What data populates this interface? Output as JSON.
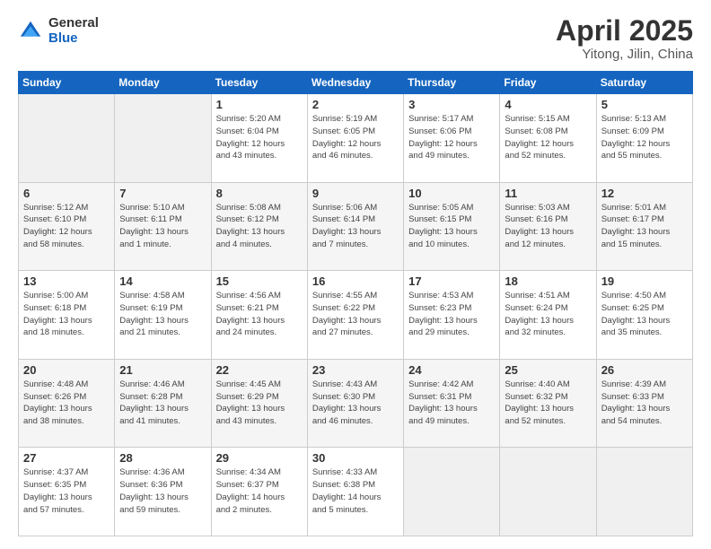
{
  "logo": {
    "general": "General",
    "blue": "Blue"
  },
  "title": {
    "month": "April 2025",
    "location": "Yitong, Jilin, China"
  },
  "days_of_week": [
    "Sunday",
    "Monday",
    "Tuesday",
    "Wednesday",
    "Thursday",
    "Friday",
    "Saturday"
  ],
  "weeks": [
    [
      {
        "day": "",
        "info": ""
      },
      {
        "day": "",
        "info": ""
      },
      {
        "day": "1",
        "info": "Sunrise: 5:20 AM\nSunset: 6:04 PM\nDaylight: 12 hours\nand 43 minutes."
      },
      {
        "day": "2",
        "info": "Sunrise: 5:19 AM\nSunset: 6:05 PM\nDaylight: 12 hours\nand 46 minutes."
      },
      {
        "day": "3",
        "info": "Sunrise: 5:17 AM\nSunset: 6:06 PM\nDaylight: 12 hours\nand 49 minutes."
      },
      {
        "day": "4",
        "info": "Sunrise: 5:15 AM\nSunset: 6:08 PM\nDaylight: 12 hours\nand 52 minutes."
      },
      {
        "day": "5",
        "info": "Sunrise: 5:13 AM\nSunset: 6:09 PM\nDaylight: 12 hours\nand 55 minutes."
      }
    ],
    [
      {
        "day": "6",
        "info": "Sunrise: 5:12 AM\nSunset: 6:10 PM\nDaylight: 12 hours\nand 58 minutes."
      },
      {
        "day": "7",
        "info": "Sunrise: 5:10 AM\nSunset: 6:11 PM\nDaylight: 13 hours\nand 1 minute."
      },
      {
        "day": "8",
        "info": "Sunrise: 5:08 AM\nSunset: 6:12 PM\nDaylight: 13 hours\nand 4 minutes."
      },
      {
        "day": "9",
        "info": "Sunrise: 5:06 AM\nSunset: 6:14 PM\nDaylight: 13 hours\nand 7 minutes."
      },
      {
        "day": "10",
        "info": "Sunrise: 5:05 AM\nSunset: 6:15 PM\nDaylight: 13 hours\nand 10 minutes."
      },
      {
        "day": "11",
        "info": "Sunrise: 5:03 AM\nSunset: 6:16 PM\nDaylight: 13 hours\nand 12 minutes."
      },
      {
        "day": "12",
        "info": "Sunrise: 5:01 AM\nSunset: 6:17 PM\nDaylight: 13 hours\nand 15 minutes."
      }
    ],
    [
      {
        "day": "13",
        "info": "Sunrise: 5:00 AM\nSunset: 6:18 PM\nDaylight: 13 hours\nand 18 minutes."
      },
      {
        "day": "14",
        "info": "Sunrise: 4:58 AM\nSunset: 6:19 PM\nDaylight: 13 hours\nand 21 minutes."
      },
      {
        "day": "15",
        "info": "Sunrise: 4:56 AM\nSunset: 6:21 PM\nDaylight: 13 hours\nand 24 minutes."
      },
      {
        "day": "16",
        "info": "Sunrise: 4:55 AM\nSunset: 6:22 PM\nDaylight: 13 hours\nand 27 minutes."
      },
      {
        "day": "17",
        "info": "Sunrise: 4:53 AM\nSunset: 6:23 PM\nDaylight: 13 hours\nand 29 minutes."
      },
      {
        "day": "18",
        "info": "Sunrise: 4:51 AM\nSunset: 6:24 PM\nDaylight: 13 hours\nand 32 minutes."
      },
      {
        "day": "19",
        "info": "Sunrise: 4:50 AM\nSunset: 6:25 PM\nDaylight: 13 hours\nand 35 minutes."
      }
    ],
    [
      {
        "day": "20",
        "info": "Sunrise: 4:48 AM\nSunset: 6:26 PM\nDaylight: 13 hours\nand 38 minutes."
      },
      {
        "day": "21",
        "info": "Sunrise: 4:46 AM\nSunset: 6:28 PM\nDaylight: 13 hours\nand 41 minutes."
      },
      {
        "day": "22",
        "info": "Sunrise: 4:45 AM\nSunset: 6:29 PM\nDaylight: 13 hours\nand 43 minutes."
      },
      {
        "day": "23",
        "info": "Sunrise: 4:43 AM\nSunset: 6:30 PM\nDaylight: 13 hours\nand 46 minutes."
      },
      {
        "day": "24",
        "info": "Sunrise: 4:42 AM\nSunset: 6:31 PM\nDaylight: 13 hours\nand 49 minutes."
      },
      {
        "day": "25",
        "info": "Sunrise: 4:40 AM\nSunset: 6:32 PM\nDaylight: 13 hours\nand 52 minutes."
      },
      {
        "day": "26",
        "info": "Sunrise: 4:39 AM\nSunset: 6:33 PM\nDaylight: 13 hours\nand 54 minutes."
      }
    ],
    [
      {
        "day": "27",
        "info": "Sunrise: 4:37 AM\nSunset: 6:35 PM\nDaylight: 13 hours\nand 57 minutes."
      },
      {
        "day": "28",
        "info": "Sunrise: 4:36 AM\nSunset: 6:36 PM\nDaylight: 13 hours\nand 59 minutes."
      },
      {
        "day": "29",
        "info": "Sunrise: 4:34 AM\nSunset: 6:37 PM\nDaylight: 14 hours\nand 2 minutes."
      },
      {
        "day": "30",
        "info": "Sunrise: 4:33 AM\nSunset: 6:38 PM\nDaylight: 14 hours\nand 5 minutes."
      },
      {
        "day": "",
        "info": ""
      },
      {
        "day": "",
        "info": ""
      },
      {
        "day": "",
        "info": ""
      }
    ]
  ]
}
